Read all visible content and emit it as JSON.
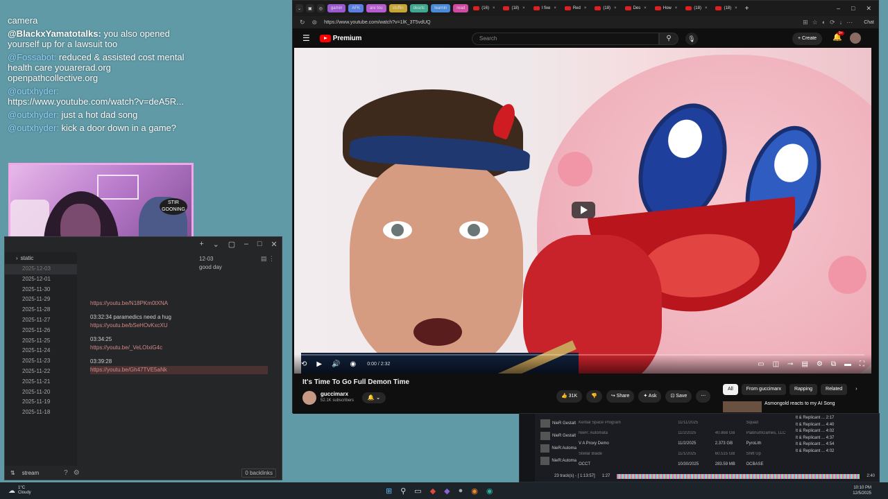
{
  "chat": [
    {
      "user": "",
      "text": "camera"
    },
    {
      "user": "@BlackxYamatotalks:",
      "text": "you also opened yourself up for a lawsuit too",
      "bold": true
    },
    {
      "user": "@Fossabot:",
      "text": "reduced & assisted cost mental health care youarerad.org openpathcollective.org"
    },
    {
      "user": "@outxhyder:",
      "text": "https://www.youtube.com/watch?v=deA5R..."
    },
    {
      "user": "@outxhyder:",
      "text": "just a hot dad song"
    },
    {
      "user": "@outxhyder:",
      "text": "kick a door down in a game?"
    }
  ],
  "webcam": {
    "sign_text": "STIR GOONING"
  },
  "notes": {
    "header_date": "12-03",
    "header_text": "good day",
    "sidebar_folder": "static",
    "dates": [
      "2025-12-03",
      "2025-12-01",
      "2025-11-30",
      "2025-11-29",
      "2025-11-28",
      "2025-11-27",
      "2025-11-26",
      "2025-11-25",
      "2025-11-24",
      "2025-11-23",
      "2025-11-22",
      "2025-11-21",
      "2025-11-20",
      "2025-11-19",
      "2025-11-18"
    ],
    "entries": [
      {
        "time": "",
        "text": "",
        "link": "https://youtu.be/N18PKm0tXNA"
      },
      {
        "time": "03:32:34",
        "text": "paramedics need a hug",
        "link": "https://youtu.be/bSeHOvKxcXU"
      },
      {
        "time": "03:34:25",
        "text": "",
        "link": "https://youtu.be/_VeLOIxiG4c"
      },
      {
        "time": "03:39:28",
        "text": "",
        "link": "https://youtu.be/Gh47TVE5aNk"
      }
    ],
    "footer": {
      "vault": "stream",
      "backlinks": "0 backlinks"
    }
  },
  "browser": {
    "tabs": [
      "gamin",
      "AFK",
      "are tou",
      "stuffin",
      "deartc",
      "learnin",
      "read"
    ],
    "yt_tabs": [
      "(16)",
      "(18)",
      "I fixe",
      "Red",
      "(18)",
      "Des",
      "How",
      "(18)",
      "(18)"
    ],
    "chat_label": "Chat",
    "url": "https://www.youtube.com/watch?v=1lK_3T5vdUQ",
    "search_placeholder": "Search",
    "logo_text": "Premium",
    "create_label": "Create",
    "notif_count": "9+",
    "video": {
      "time": "0:00 / 2:32"
    },
    "title": "It's Time To Go Full Demon Time",
    "channel": "guccimarx",
    "subscribers": "52.1K subscribers",
    "likes": "31K",
    "actions": [
      "Share",
      "Ask",
      "Save"
    ],
    "chips": [
      "All",
      "From guccimarx",
      "Rapping",
      "Related"
    ],
    "rec_title": "Asmongold reacts to my AI Song"
  },
  "player": {
    "left_items": [
      "NieR Gestalt",
      "NieR Gestalt",
      "NieR:Automa",
      "NieR:Automa"
    ],
    "rows": [
      {
        "name": "Kerbal Space Program",
        "date": "11/11/2025",
        "size": "",
        "publisher": "Squad",
        "dim": true
      },
      {
        "name": "NieR: Automata",
        "date": "11/2/2025",
        "size": "40.868 GB",
        "publisher": "PlatinumGames, LLC",
        "dim": true
      },
      {
        "name": "V A Proxy Demo",
        "date": "11/2/2025",
        "size": "2.373 GB",
        "publisher": "PyroLith",
        "dim": false
      },
      {
        "name": "Stellar Blade",
        "date": "11/1/2025",
        "size": "60.515 GB",
        "publisher": "Shift Up",
        "dim": true
      },
      {
        "name": "OCCT",
        "date": "10/30/2025",
        "size": "283.59 MB",
        "publisher": "OCBASE",
        "dim": false
      }
    ],
    "right_items": [
      "lt & Replicant ... 2:17",
      "lt & Replicant ... 4:40",
      "lt & Replicant ... 4:02",
      "lt & Replicant ... 4:37",
      "lt & Replicant ... 4:54",
      "lt & Replicant ... 4:02"
    ],
    "status": "23 track(s) - [ 1:13:57]",
    "pos": "1:27",
    "end": "2:40"
  },
  "taskbar": {
    "temp": "1°C",
    "weather": "Cloudy",
    "time": "10:10 PM",
    "date": "12/5/2025"
  }
}
